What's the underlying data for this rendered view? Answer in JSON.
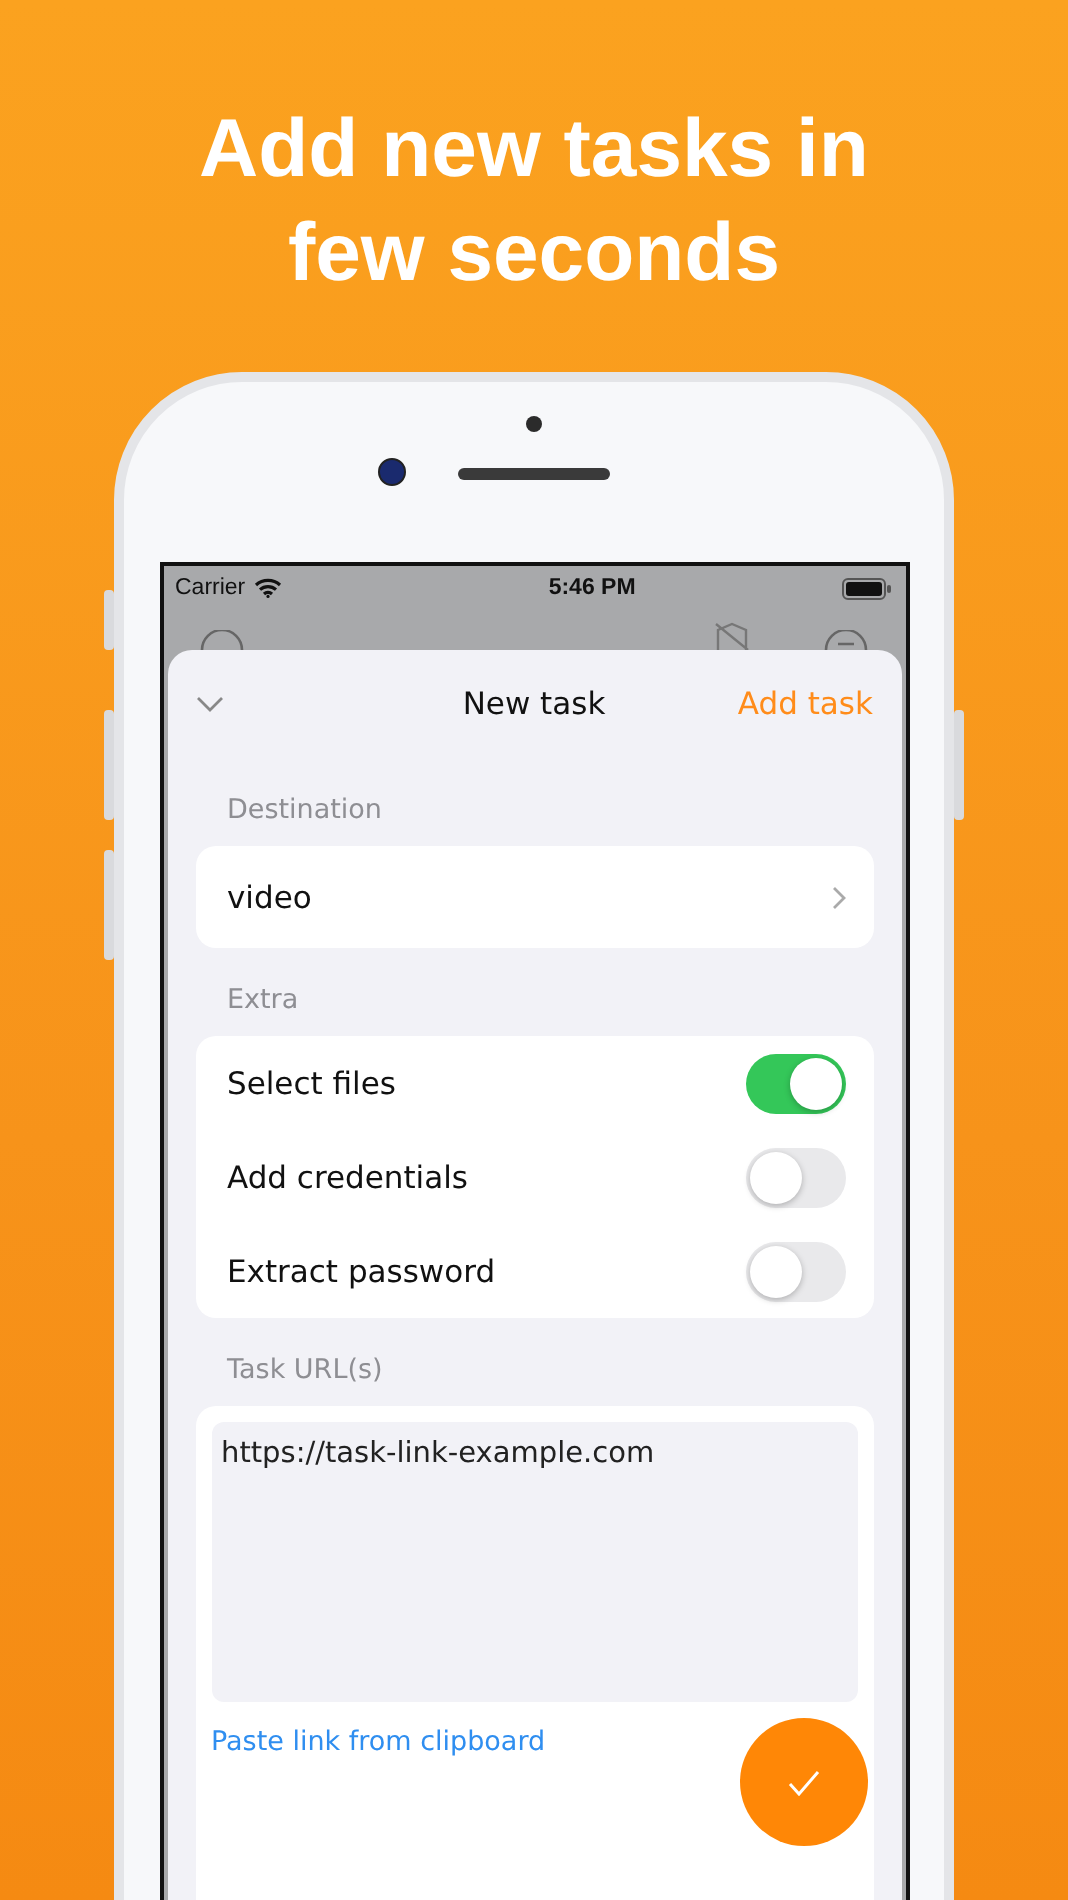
{
  "headline": "Add new tasks in few seconds",
  "status_bar": {
    "carrier": "Carrier",
    "time": "5:46 PM"
  },
  "sheet": {
    "title": "New task",
    "action": "Add task"
  },
  "destination": {
    "label": "Destination",
    "value": "video"
  },
  "extra": {
    "label": "Extra",
    "options": [
      {
        "label": "Select files",
        "on": true
      },
      {
        "label": "Add credentials",
        "on": false
      },
      {
        "label": "Extract password",
        "on": false
      }
    ]
  },
  "task_urls": {
    "label": "Task URL(s)",
    "value": "https://task-link-example.com",
    "paste_link": "Paste link from clipboard"
  }
}
